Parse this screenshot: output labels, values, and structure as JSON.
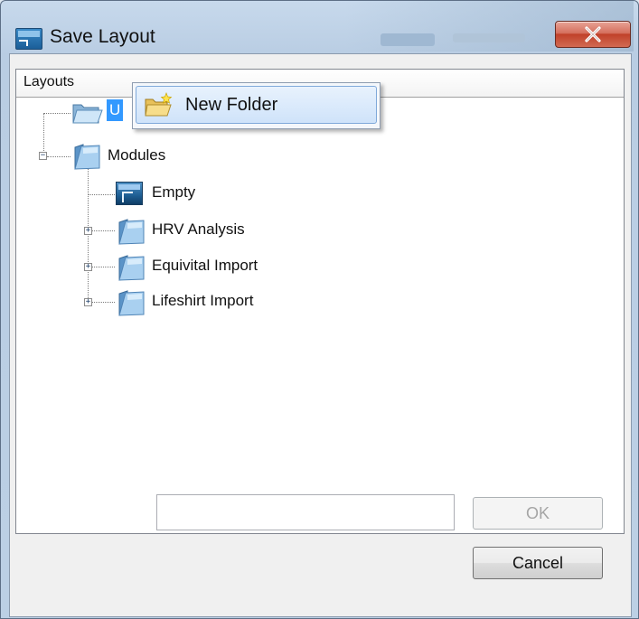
{
  "window": {
    "title": "Save Layout",
    "close_glyph": "X"
  },
  "tree": {
    "header": "Layouts",
    "nodes": [
      {
        "label": "U",
        "icon": "open-folder-icon",
        "selected": true
      },
      {
        "label": "Modules",
        "icon": "folder-icon",
        "expanded": true
      },
      {
        "label": "Empty",
        "icon": "module-icon"
      },
      {
        "label": "HRV Analysis",
        "icon": "folder-icon",
        "expanded": false
      },
      {
        "label": "Equivital Import",
        "icon": "folder-icon",
        "expanded": false
      },
      {
        "label": "Lifeshirt Import",
        "icon": "folder-icon",
        "expanded": false
      }
    ]
  },
  "context_menu": {
    "items": [
      {
        "label": "New Folder",
        "icon": "new-folder-icon"
      }
    ]
  },
  "form": {
    "name_value": "",
    "ok_label": "OK",
    "cancel_label": "Cancel"
  },
  "colors": {
    "selection": "#3399ff",
    "close_button": "#c0412a",
    "menu_highlight": "#cfe3fa"
  }
}
